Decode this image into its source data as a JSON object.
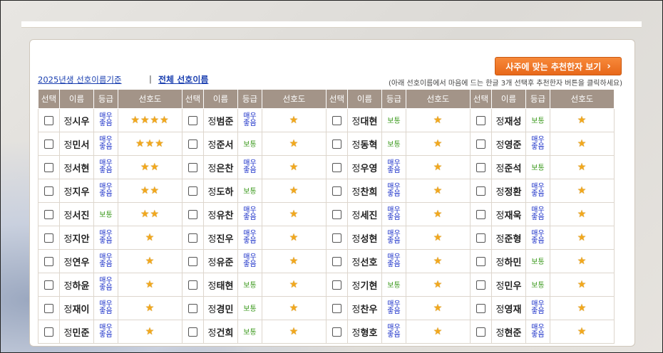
{
  "header": {
    "recommend_button": "사주에 맞는 추천한자 보기",
    "recommend_chevron": "›",
    "year_link": "2025년생 선호이름기준",
    "separator": "|",
    "all_link": "전체 선호이름",
    "hint": "(아래 선호이름에서 마음에 드는 한글 3개 선택후 추천한자 버튼을 클릭하세요)"
  },
  "columns": [
    "선택",
    "이름",
    "등급",
    "선호도"
  ],
  "surname": "정",
  "grade_labels": {
    "very": "매우\n좋음",
    "normal": "보통"
  },
  "icons": {
    "checkbox": "checkbox-icon",
    "star": "star-icon",
    "chevron": "chevron-right-icon"
  },
  "colors": {
    "header_bg": "#a39488",
    "button": "#f07a2a",
    "very_good": "#1a2fc8",
    "normal": "#3c9a1e",
    "star": "#f2a81d"
  },
  "groups": [
    {
      "rows": [
        {
          "given": "시우",
          "grade": "very",
          "stars": 4
        },
        {
          "given": "민서",
          "grade": "very",
          "stars": 3
        },
        {
          "given": "서현",
          "grade": "very",
          "stars": 2
        },
        {
          "given": "지우",
          "grade": "very",
          "stars": 2
        },
        {
          "given": "서진",
          "grade": "normal",
          "stars": 2
        },
        {
          "given": "지안",
          "grade": "very",
          "stars": 1
        },
        {
          "given": "연우",
          "grade": "very",
          "stars": 1
        },
        {
          "given": "하윤",
          "grade": "very",
          "stars": 1
        },
        {
          "given": "재이",
          "grade": "very",
          "stars": 1
        },
        {
          "given": "민준",
          "grade": "very",
          "stars": 1
        }
      ]
    },
    {
      "rows": [
        {
          "given": "범준",
          "grade": "very",
          "stars": 1
        },
        {
          "given": "준서",
          "grade": "normal",
          "stars": 1
        },
        {
          "given": "은찬",
          "grade": "very",
          "stars": 1
        },
        {
          "given": "도하",
          "grade": "normal",
          "stars": 1
        },
        {
          "given": "유찬",
          "grade": "very",
          "stars": 1
        },
        {
          "given": "진우",
          "grade": "very",
          "stars": 1
        },
        {
          "given": "유준",
          "grade": "very",
          "stars": 1
        },
        {
          "given": "태현",
          "grade": "normal",
          "stars": 1
        },
        {
          "given": "경민",
          "grade": "normal",
          "stars": 1
        },
        {
          "given": "건희",
          "grade": "normal",
          "stars": 1
        }
      ]
    },
    {
      "rows": [
        {
          "given": "대현",
          "grade": "normal",
          "stars": 1
        },
        {
          "given": "동혁",
          "grade": "normal",
          "stars": 1
        },
        {
          "given": "우영",
          "grade": "very",
          "stars": 1
        },
        {
          "given": "찬희",
          "grade": "very",
          "stars": 1
        },
        {
          "given": "세진",
          "grade": "very",
          "stars": 1
        },
        {
          "given": "성현",
          "grade": "very",
          "stars": 1
        },
        {
          "given": "선호",
          "grade": "very",
          "stars": 1
        },
        {
          "given": "기현",
          "grade": "normal",
          "stars": 1
        },
        {
          "given": "찬우",
          "grade": "very",
          "stars": 1
        },
        {
          "given": "형호",
          "grade": "very",
          "stars": 1
        }
      ]
    },
    {
      "rows": [
        {
          "given": "재성",
          "grade": "normal",
          "stars": 1
        },
        {
          "given": "영준",
          "grade": "very",
          "stars": 1
        },
        {
          "given": "준석",
          "grade": "normal",
          "stars": 1
        },
        {
          "given": "정환",
          "grade": "very",
          "stars": 1
        },
        {
          "given": "재욱",
          "grade": "very",
          "stars": 1
        },
        {
          "given": "준형",
          "grade": "very",
          "stars": 1
        },
        {
          "given": "하민",
          "grade": "normal",
          "stars": 1
        },
        {
          "given": "민우",
          "grade": "normal",
          "stars": 1
        },
        {
          "given": "영재",
          "grade": "very",
          "stars": 1
        },
        {
          "given": "현준",
          "grade": "very",
          "stars": 1
        }
      ]
    }
  ]
}
